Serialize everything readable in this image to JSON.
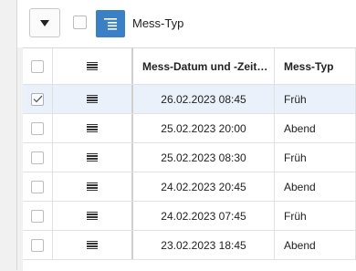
{
  "toolbar": {
    "group_label": "Mess-Typ",
    "icons": {
      "dropdown": "triangle-down-icon",
      "group": "group-by-icon"
    }
  },
  "grid": {
    "columns": {
      "date": "Mess-Datum und -Zeit…",
      "type": "Mess-Typ"
    },
    "rows": [
      {
        "date": "26.02.2023 08:45",
        "type": "Früh",
        "selected": true
      },
      {
        "date": "25.02.2023 20:00",
        "type": "Abend",
        "selected": false
      },
      {
        "date": "25.02.2023 08:30",
        "type": "Früh",
        "selected": false
      },
      {
        "date": "24.02.2023 20:45",
        "type": "Abend",
        "selected": false
      },
      {
        "date": "24.02.2023 07:45",
        "type": "Früh",
        "selected": false
      },
      {
        "date": "23.02.2023 18:45",
        "type": "Abend",
        "selected": false
      }
    ]
  },
  "colors": {
    "accent": "#3b7fc4",
    "selected_row": "#eaf1fa"
  }
}
